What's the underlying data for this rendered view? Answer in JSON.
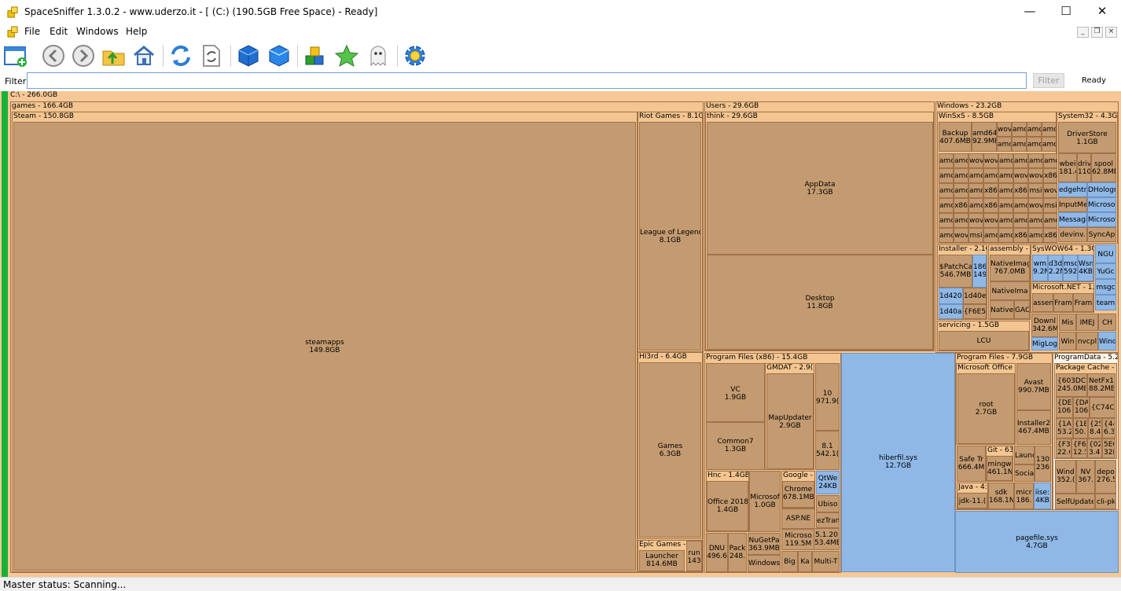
{
  "window": {
    "title": "SpaceSniffer 1.3.0.2 - www.uderzo.it - [ (C:) (190.5GB Free Space) - Ready]",
    "minimize": "—",
    "maximize": "☐",
    "close": "✕"
  },
  "menu": {
    "file": "File",
    "edit": "Edit",
    "windows": "Windows",
    "help": "Help",
    "mdi_min": "_",
    "mdi_restore": "❐",
    "mdi_close": "×"
  },
  "toolbar": {
    "icons": [
      "new-window-icon",
      "back-icon",
      "forward-icon",
      "up-folder-icon",
      "home-icon",
      "refresh-icon",
      "refresh-document-icon",
      "blue-cube-icon",
      "blue-cube-alt-icon",
      "colored-blocks-icon",
      "green-star-icon",
      "ghost-icon",
      "gear-icon"
    ]
  },
  "filter": {
    "label": "Filter",
    "value": "",
    "button": "Filter",
    "status": "Ready"
  },
  "colors": {
    "file_block": "#c49b70",
    "header_block": "#f3c590",
    "blue_block": "#8fb8e6",
    "green_bar": "#17b236"
  },
  "treemap": {
    "root": "C:\\ - 266.0GB",
    "games": {
      "header": "games - 166.4GB"
    },
    "steam": {
      "header": "Steam - 150.8GB",
      "steamapps": {
        "name": "steamapps",
        "size": "149.8GB"
      }
    },
    "riot": {
      "header": "Riot Games - 8.1GB",
      "lol": {
        "name": "League of Legends",
        "size": "8.1GB"
      }
    },
    "hi3rd": {
      "header": "HI3rd - 6.4GB",
      "games": {
        "name": "Games",
        "size": "6.3GB"
      }
    },
    "epic": {
      "header": "Epic Games - ",
      "launcher": {
        "name": "Launcher",
        "size": "814.6MB"
      },
      "run": {
        "name": "run",
        "size": "143"
      }
    },
    "users": {
      "header": "Users - 29.6GB",
      "think": {
        "header": "think - 29.6GB"
      },
      "appdata": {
        "name": "AppData",
        "size": "17.3GB"
      },
      "desktop": {
        "name": "Desktop",
        "size": "11.8GB"
      }
    },
    "pf86": {
      "header": "Program Files (x86) - 15.4GB",
      "vc": {
        "name": "VC",
        "size": "1.9GB"
      },
      "common7": {
        "name": "Common7",
        "size": "1.3GB"
      },
      "gmdat": {
        "header": "GMDAT - 2.9(",
        "mapupdater": {
          "name": "MapUpdater",
          "size": "2.9GB"
        }
      },
      "ten": {
        "name": "10",
        "size": "971.9("
      },
      "eightone": {
        "name": "8.1",
        "size": "542.1("
      },
      "hnc": {
        "header": "Hnc - 1.4GB",
        "office": {
          "name": "Office 2018",
          "size": "1.4GB"
        }
      },
      "microsoft": {
        "name": "Microsof",
        "size": "1.0GB"
      },
      "google": {
        "header": "Google - (",
        "chrome": {
          "name": "Chrome",
          "size": "678.1MB"
        }
      },
      "qtwe": {
        "name": "QtWe",
        "size": "24KB"
      },
      "ubisoft": {
        "name": "Ubiso"
      },
      "aspnet": {
        "name": "ASP.NE"
      },
      "eztrans": {
        "name": "ezTran"
      },
      "microsoft2": {
        "name": "Microso",
        "size": "119.5M"
      },
      "v512": {
        "name": "5.1.20",
        "size": "53.4ME"
      },
      "dnu": {
        "name": "DNU",
        "size": "496.6"
      },
      "pack": {
        "name": "Pack",
        "size": "248."
      },
      "nugetpa": {
        "name": "NuGetPa",
        "size": "363.9MB"
      },
      "windows": {
        "name": "Windows"
      },
      "big": {
        "name": "Big"
      },
      "ka": {
        "name": "Ka"
      },
      "multit": {
        "name": "Multi-T"
      }
    },
    "hiberfil": {
      "name": "hiberfil.sys",
      "size": "12.7GB"
    },
    "windows": {
      "header": "Windows - 23.2GB",
      "winsxs": {
        "header": "WinSxS - 8.5GB",
        "backup": {
          "name": "Backup",
          "size": "407.6MB"
        },
        "amd64": {
          "name": "amd64",
          "size": "92.9MB"
        }
      },
      "system32": {
        "header": "System32 - 4.3GB",
        "driverstore": {
          "name": "DriverStore",
          "size": "1.1GB"
        },
        "wbem": {
          "name": "wbei",
          "size": "181.4"
        },
        "drivers": {
          "name": "driv",
          "size": "110"
        },
        "spool": {
          "name": "spool",
          "size": "62.8MB"
        },
        "edgehtml": {
          "name": "edgehtn"
        },
        "dholog": {
          "name": "DHologr"
        },
        "inputme": {
          "name": "InputMe"
        },
        "microsof1": {
          "name": "Microsof"
        },
        "messagi": {
          "name": "Messagi"
        },
        "microsof2": {
          "name": "Microsof"
        },
        "devinv": {
          "name": "devinv."
        },
        "syncap": {
          "name": "SyncAp"
        }
      },
      "installer": {
        "header": "Installer - 2.1G",
        "patchcache": {
          "name": "$PatchCa",
          "size": "546.7MB"
        },
        "b186": {
          "name": "186",
          "size": "149"
        },
        "d4207": {
          "name": "1d4207"
        },
        "d40e": {
          "name": "1d40e:"
        },
        "d40a": {
          "name": "1d40a7"
        },
        "f6e5": {
          "name": "{F6E5"
        }
      },
      "assembly": {
        "header": "assembly - 1",
        "nativeimg1": {
          "name": "NativeImag",
          "size": "767.0MB"
        },
        "nativeimg2": {
          "name": "NativeIma"
        },
        "native": {
          "name": "Native"
        },
        "gac": {
          "name": "GAC"
        }
      },
      "syswow": {
        "header": "SysWOW64 - 1.3G",
        "wm": {
          "name": "wm",
          "size": "9.2N"
        },
        "d3d": {
          "name": "d3d",
          "size": "2.2N"
        },
        "msc": {
          "name": "msc",
          "size": "592"
        },
        "wsn": {
          "name": "Wsn",
          "size": "4KB"
        },
        "ngu": {
          "name": "NGU"
        },
        "yugo": {
          "name": "YuGc"
        },
        "msgc": {
          "name": "msgc"
        },
        "team": {
          "name": "team"
        }
      },
      "dotnet": {
        "header": "Microsoft.NET - 1.(",
        "assem": {
          "name": "assen"
        },
        "fram1": {
          "name": "Fram"
        },
        "fram2": {
          "name": "Fram"
        }
      },
      "servicing": {
        "header": "servicing - 1.5GB",
        "lcu": {
          "name": "LCU"
        }
      },
      "download": {
        "name": "Downl",
        "size": "342.6M"
      },
      "misc": {
        "name": "Mis"
      },
      "imej": {
        "name": "IMEJ"
      },
      "ch": {
        "name": "CH"
      },
      "miglog": {
        "name": "MigLog"
      },
      "win": {
        "name": "Win"
      },
      "nvcpl": {
        "name": "nvcpl"
      },
      "wind": {
        "name": "Wind"
      },
      "tiles": [
        "wov",
        "amc",
        "amc",
        "amc",
        "amc",
        "amc",
        "amc",
        "amc",
        "amc",
        "amc",
        "wov",
        "wov",
        "amc",
        "amc",
        "amc",
        "amc",
        "amc",
        "amc",
        "amc",
        "amc",
        "amc",
        "wov",
        "wov",
        "x86",
        "amc",
        "amc",
        "amc",
        "x86",
        "amc",
        "x86",
        "msi",
        "wov",
        "amc",
        "x86",
        "amc",
        "x86",
        "amc",
        "amc",
        "wov",
        "msi",
        "amc",
        "amc",
        "wov",
        "wov",
        "amc",
        "amc",
        "amc",
        "amc",
        "amc",
        "wov",
        "msi",
        "amc",
        "amc",
        "x86",
        "amc",
        "x86",
        "amc",
        "wov",
        "wov",
        "amc",
        "amc",
        "amc",
        "amc",
        "amc",
        "amc"
      ]
    },
    "pagefile": {
      "name": "pagefile.sys",
      "size": "4.7GB"
    },
    "progfiles": {
      "header": "Program Files - 7.9GB",
      "msoffice": {
        "header": "Microsoft Office - ",
        "root": {
          "name": "root",
          "size": "2.7GB"
        }
      },
      "avast": {
        "name": "Avast",
        "size": "990.7MB"
      },
      "installer2": {
        "name": "Installer2",
        "size": "467.4MB"
      },
      "safetr": {
        "name": "Safe Tr",
        "size": "666.4M"
      },
      "git": {
        "header": "Git - 63",
        "mingw": {
          "name": "mingw",
          "size": "461.1N"
        }
      },
      "java": {
        "header": "Java - 4:",
        "jdk": {
          "name": "jdk-11.("
        }
      },
      "sdk": {
        "name": "sdk",
        "size": "168.1N"
      },
      "laun": {
        "name": "Launc"
      },
      "soci": {
        "name": "Socia"
      },
      "micr": {
        "name": "micr",
        "size": "186."
      },
      "n130": {
        "name": "130",
        "size": "236"
      },
      "iise": {
        "name": "iise:",
        "size": "4KB"
      }
    },
    "programdata": {
      "header": "ProgramData - 5.2(",
      "pkgcache": {
        "header": "Package Cache - 3",
        "b603": {
          "name": "{603DCF",
          "size": "245.0MB"
        },
        "netfx": {
          "name": "NetFx1e",
          "size": "88.2MB"
        },
        "de": {
          "name": "{DE",
          "size": "106."
        },
        "da": {
          "name": "{DA",
          "size": "106"
        },
        "c74": {
          "name": "{C74CE"
        },
        "a1": {
          "name": "{1A",
          "size": "53.2"
        },
        "b1b": {
          "name": "{1B",
          "size": "50.:"
        },
        "b25": {
          "name": "{25E",
          "size": "8.4N"
        },
        "b44": {
          "name": "{44",
          "size": "6.3("
        },
        "f3": {
          "name": "{F3",
          "size": "22.6"
        },
        "f6": {
          "name": "{F6",
          "size": "12.5"
        },
        "b02": {
          "name": "{02",
          "size": "3.4N"
        },
        "b5e": {
          "name": "5EC",
          "size": "32K"
        }
      },
      "windows": {
        "name": "Windo",
        "size": "352.("
      },
      "nv": {
        "name": "NV",
        "size": "367."
      },
      "depot": {
        "name": "depo",
        "size": "276.5"
      },
      "selfupdate": {
        "name": "SelfUpdate"
      },
      "clipk": {
        "name": "cli-pk"
      }
    }
  },
  "status": {
    "text": "Master status: Scanning..."
  }
}
